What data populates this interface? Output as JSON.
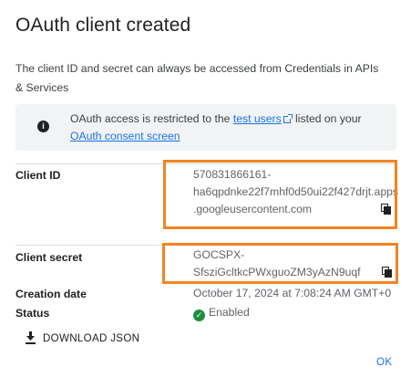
{
  "dialog": {
    "title": "OAuth client created",
    "intro": "The client ID and secret can always be accessed from Credentials in APIs & Services"
  },
  "info": {
    "icon": "info-icon",
    "text_before": "OAuth access is restricted to the ",
    "test_users_link": "test users",
    "text_after": " listed on your",
    "consent_link": "OAuth consent screen"
  },
  "fields": {
    "client_id": {
      "label": "Client ID",
      "line1": "570831866161-",
      "line2": "ha6qpdnke22f7mhf0d50ui22f427drjt.apps",
      "line3": ".googleusercontent.com"
    },
    "client_secret": {
      "label": "Client secret",
      "line1": "GOCSPX-",
      "line2": "SfsziGcltkcPWxguoZM3yAzN9uqf"
    },
    "creation_date": {
      "label": "Creation date",
      "value": "October 17, 2024 at 7:08:24 AM GMT+0"
    },
    "status": {
      "label": "Status",
      "value": "Enabled"
    }
  },
  "actions": {
    "download_label": "DOWNLOAD JSON",
    "ok_label": "OK"
  },
  "colors": {
    "accent": "#1a73e8",
    "highlight": "#f28520",
    "status_ok": "#1e8e3e"
  }
}
